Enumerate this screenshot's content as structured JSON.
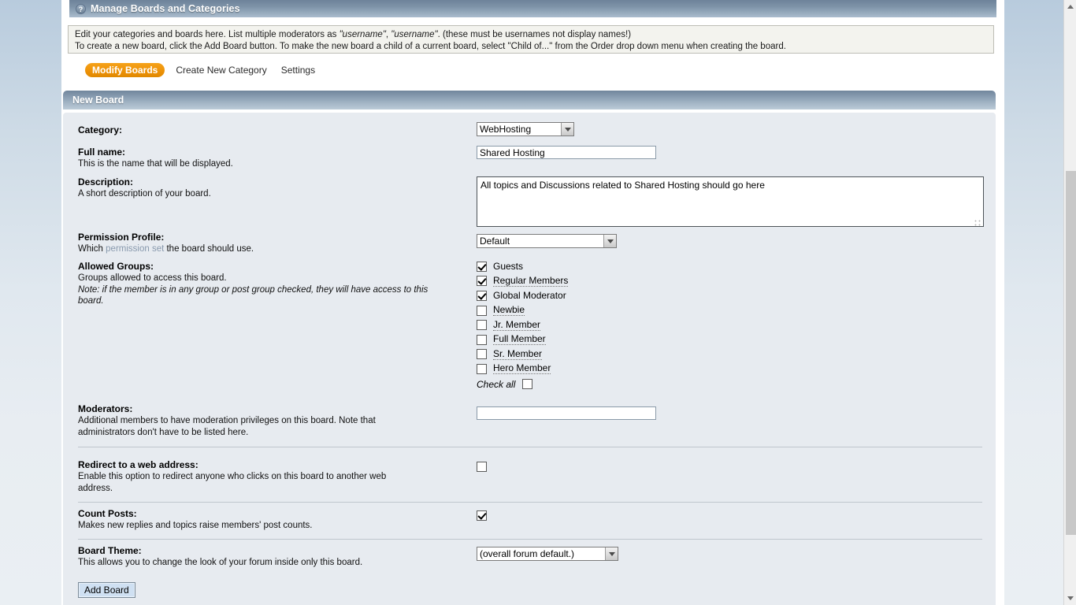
{
  "window": {
    "category_bar_title": "Manage Boards and Categories",
    "help_icon_glyph": "?"
  },
  "info_box": {
    "line1_part1": "Edit your categories and boards here. List multiple moderators as ",
    "line1_em1": "\"username\"",
    "line1_part2": ", ",
    "line1_em2": "\"username\"",
    "line1_part3": ". (these must be usernames not display names!)",
    "line2": "To create a new board, click the Add Board button. To make the new board a child of a current board, select \"Child of...\" from the Order drop down menu when creating the board."
  },
  "tabs": [
    {
      "label": "Modify Boards",
      "active": true
    },
    {
      "label": "Create New Category",
      "active": false
    },
    {
      "label": "Settings",
      "active": false
    }
  ],
  "panel": {
    "header_title": "New Board"
  },
  "form": {
    "category": {
      "label": "Category:",
      "value": "WebHosting",
      "options": [
        "WebHosting"
      ]
    },
    "full_name": {
      "label": "Full name:",
      "hint": "This is the name that will be displayed.",
      "value": "Shared Hosting",
      "placeholder": ""
    },
    "description": {
      "label": "Description:",
      "hint": "A short description of your board.",
      "value": "All topics and Discussions related to Shared Hosting should go here",
      "placeholder": ""
    },
    "permission_profile": {
      "label": "Permission Profile:",
      "hint_before": "Which ",
      "hint_link": "permission set",
      "hint_after": " the board should use.",
      "value": "Default",
      "options": [
        "Default"
      ]
    },
    "allowed_groups": {
      "label": "Allowed Groups:",
      "hint": "Groups allowed to access this board.",
      "note": "Note: if the member is in any group or post group checked, they will have access to this board.",
      "items": [
        {
          "label": "Guests",
          "checked": true,
          "dotted": false
        },
        {
          "label": "Regular Members",
          "checked": true,
          "dotted": true
        },
        {
          "label": "Global Moderator",
          "checked": true,
          "dotted": false
        },
        {
          "label": "Newbie",
          "checked": false,
          "dotted": true
        },
        {
          "label": "Jr. Member",
          "checked": false,
          "dotted": true
        },
        {
          "label": "Full Member",
          "checked": false,
          "dotted": true
        },
        {
          "label": "Sr. Member",
          "checked": false,
          "dotted": true
        },
        {
          "label": "Hero Member",
          "checked": false,
          "dotted": true
        }
      ],
      "check_all_label": "Check all",
      "check_all_checked": false
    },
    "moderators": {
      "label": "Moderators:",
      "hint_line1": "Additional members to have moderation privileges on this board. Note that",
      "hint_line2": "administrators don't have to be listed here.",
      "value": "",
      "placeholder": ""
    },
    "redirect": {
      "label": "Redirect to a web address:",
      "hint_line1": "Enable this option to redirect anyone who clicks on this board to another web",
      "hint_line2": "address.",
      "checked": false
    },
    "count_posts": {
      "label": "Count Posts:",
      "hint": "Makes new replies and topics raise members' post counts.",
      "checked": true
    },
    "board_theme": {
      "label": "Board Theme:",
      "hint": "This allows you to change the look of your forum inside only this board.",
      "value": "(overall forum default.)",
      "options": [
        "(overall forum default.)"
      ]
    },
    "submit": {
      "label": "Add Board"
    }
  },
  "colors": {
    "accent_orange": "#ef9409",
    "panel_bg": "#e7ebf0",
    "header_slate": "#8ea3b6",
    "link_blue": "#8899ad",
    "button_blue": "#cfe0f2"
  },
  "scrollbar": {
    "up_arrow": "scroll-up",
    "down_arrow": "scroll-down"
  }
}
